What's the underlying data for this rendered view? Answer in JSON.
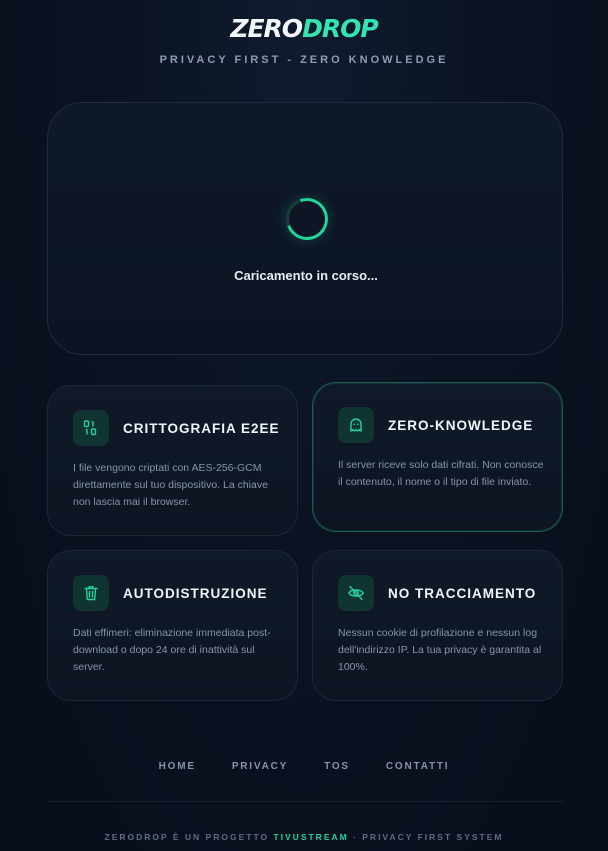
{
  "header": {
    "logo_part1": "ZERO",
    "logo_part2": "DROP",
    "tagline": "PRIVACY FIRST - ZERO KNOWLEDGE"
  },
  "loader": {
    "text": "Caricamento in corso..."
  },
  "features": [
    {
      "icon": "binary-icon",
      "title": "CRITTOGRAFIA E2EE",
      "description": "I file vengono criptati con AES-256-GCM direttamente sul tuo dispositivo. La chiave non lascia mai il browser."
    },
    {
      "icon": "ghost-icon",
      "title": "ZERO-KNOWLEDGE",
      "description": "Il server riceve solo dati cifrati. Non conosce il contenuto, il nome o il tipo di file inviato."
    },
    {
      "icon": "trash-icon",
      "title": "AUTODISTRUZIONE",
      "description": "Dati effimeri: eliminazione immediata post-download o dopo 24 ore di inattività sul server."
    },
    {
      "icon": "eye-slash-icon",
      "title": "NO TRACCIAMENTO",
      "description": "Nessun cookie di profilazione e nessun log dell'indirizzo IP. La tua privacy è garantita al 100%."
    }
  ],
  "footer": {
    "nav": [
      "HOME",
      "PRIVACY",
      "TOS",
      "CONTATTI"
    ],
    "credits_prefix": "ZERODROP È UN PROGETTO ",
    "credits_brand": "TIVUSTREAM",
    "credits_suffix": " · PRIVACY FIRST SYSTEM"
  },
  "colors": {
    "accent": "#22d49a",
    "background": "#0a1120",
    "card_border": "#1d2738"
  }
}
